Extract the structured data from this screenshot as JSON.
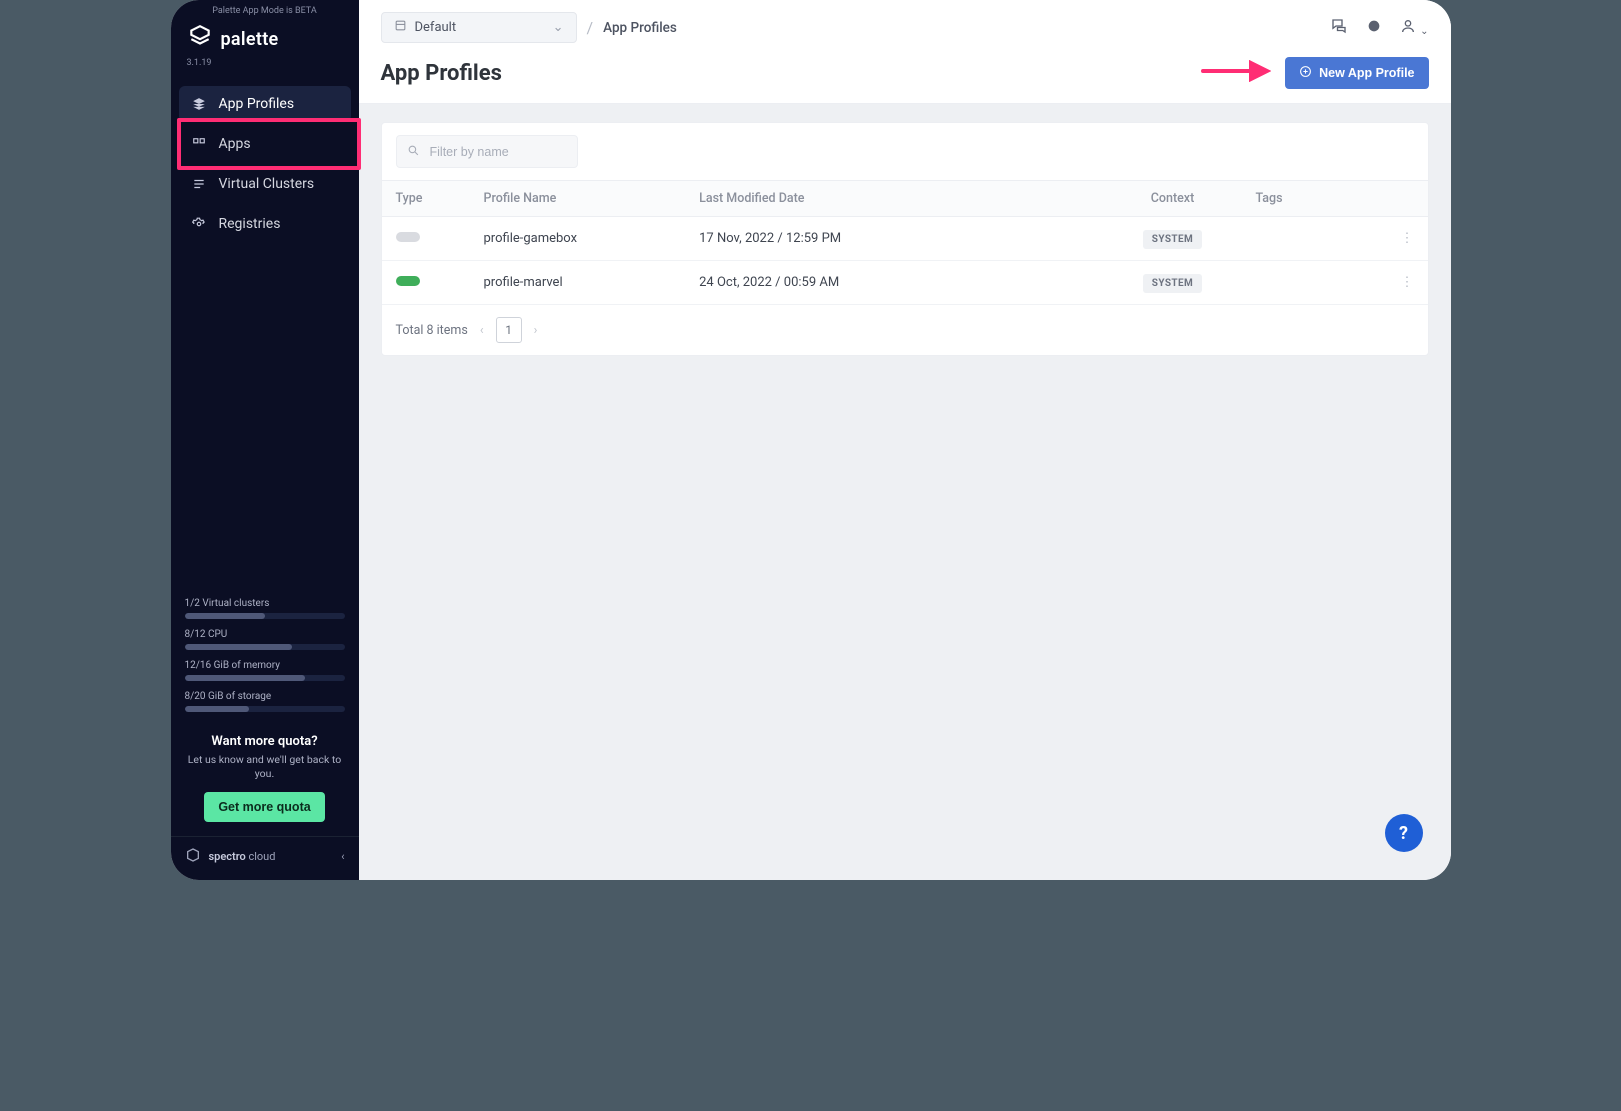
{
  "beta_text": "Palette App Mode is BETA",
  "brand": "palette",
  "version": "3.1.19",
  "sidebar": {
    "items": [
      {
        "label": "App Profiles"
      },
      {
        "label": "Apps"
      },
      {
        "label": "Virtual Clusters"
      },
      {
        "label": "Registries"
      }
    ]
  },
  "quota": [
    {
      "label": "1/2 Virtual clusters",
      "pct": 50
    },
    {
      "label": "8/12 CPU",
      "pct": 67
    },
    {
      "label": "12/16 GiB of memory",
      "pct": 75
    },
    {
      "label": "8/20 GiB of storage",
      "pct": 40
    }
  ],
  "more": {
    "title": "Want more quota?",
    "desc": "Let us know and we'll get back to you.",
    "btn": "Get more quota"
  },
  "foot": {
    "brand_strong": "spectro",
    "brand_light": "cloud"
  },
  "header": {
    "selector": "Default",
    "crumb": "App Profiles"
  },
  "page": {
    "title": "App Profiles",
    "new_btn": "New App Profile"
  },
  "search": {
    "placeholder": "Filter by name"
  },
  "columns": {
    "type": "Type",
    "name": "Profile Name",
    "date": "Last Modified Date",
    "context": "Context",
    "tags": "Tags"
  },
  "rows": [
    {
      "name": "profile-gamebox",
      "date": "17 Nov, 2022 / 12:59 PM",
      "context": "SYSTEM",
      "color": "#d9dbe0"
    },
    {
      "name": "profile-marvel",
      "date": "24 Oct, 2022 / 00:59 AM",
      "context": "SYSTEM",
      "color": "#3fae5a"
    }
  ],
  "pagination": {
    "total": "Total 8 items",
    "page": "1"
  }
}
